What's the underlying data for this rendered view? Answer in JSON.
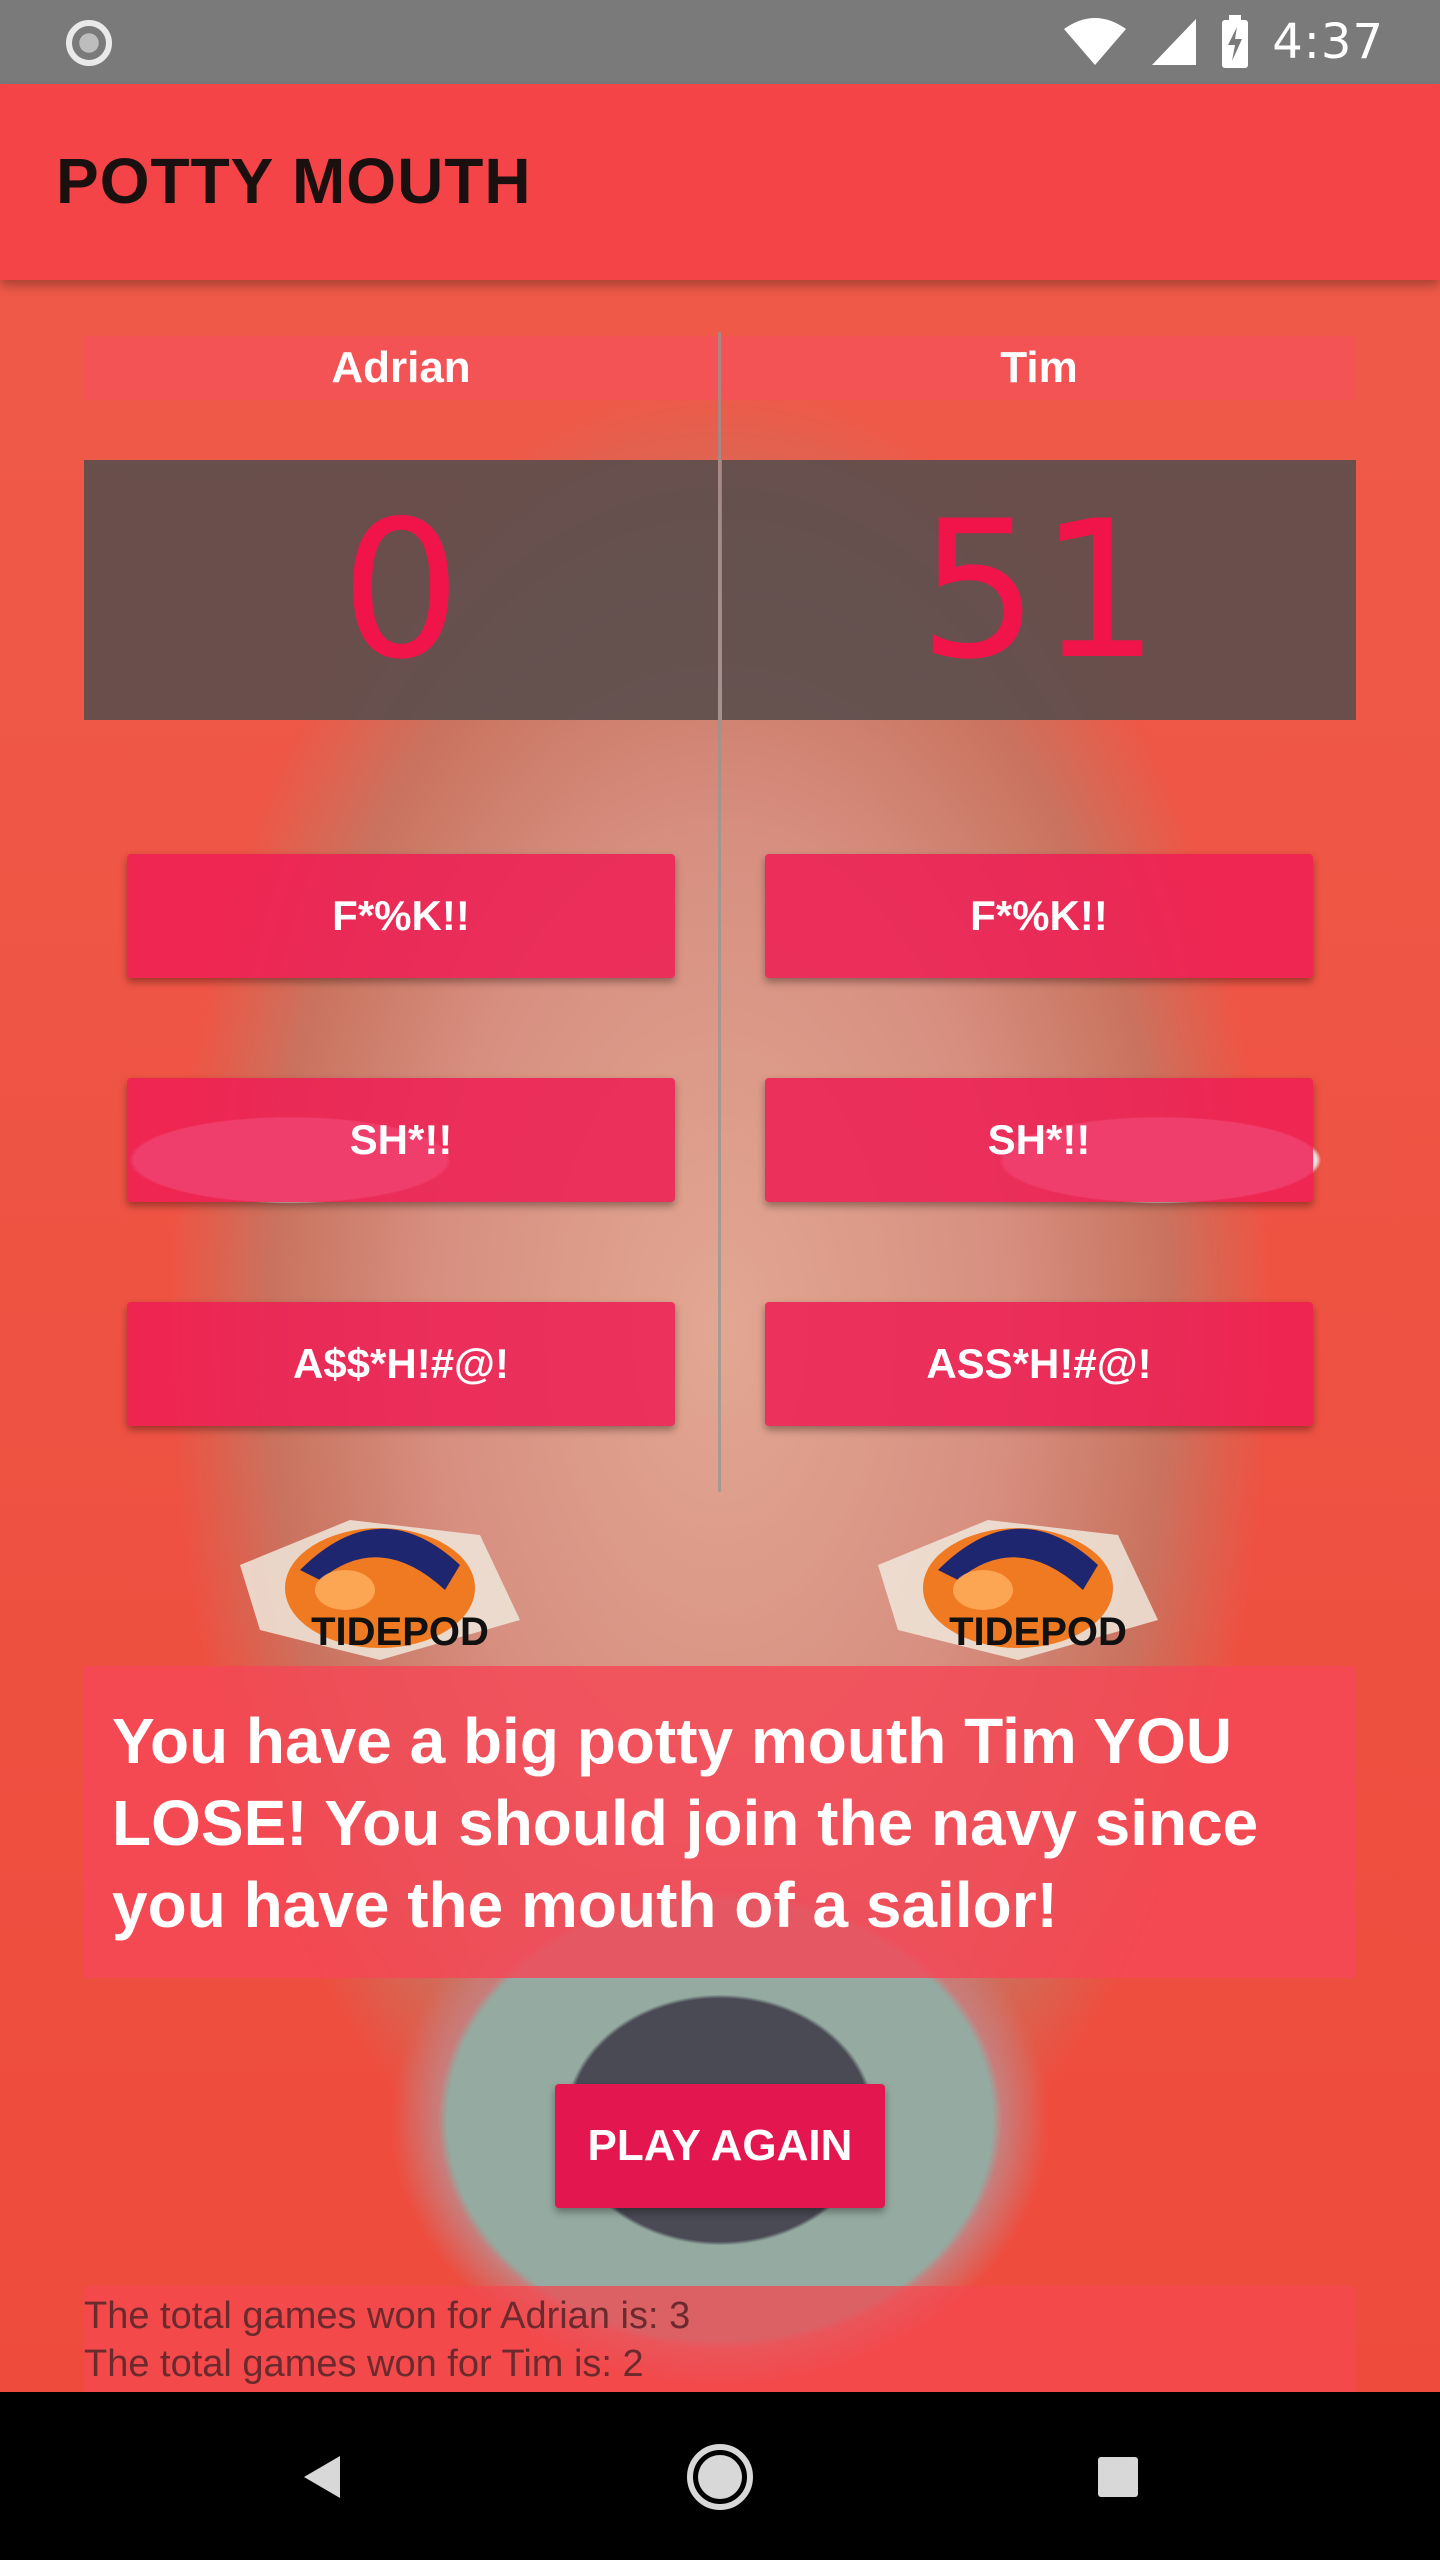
{
  "status_bar": {
    "time": "4:37",
    "icons": [
      "loading-spinner-icon",
      "wifi-icon",
      "cell-signal-icon",
      "battery-charging-icon"
    ]
  },
  "app_bar": {
    "title": "POTTY MOUTH"
  },
  "players": [
    {
      "name": "Adrian",
      "score": "0",
      "buttons": [
        "F*%K!!",
        "SH*!!",
        "A$$*H!#@!"
      ],
      "tidepod_label": "TIDEPOD"
    },
    {
      "name": "Tim",
      "score": "51",
      "buttons": [
        "F*%K!!",
        "SH*!!",
        "ASS*H!#@!"
      ],
      "tidepod_label": "TIDEPOD"
    }
  ],
  "message": "You have a big potty mouth Tim YOU LOSE! You should join the navy since you have the mouth of a sailor!",
  "play_again_label": "PLAY AGAIN",
  "totals": {
    "line1": "The total games won for Adrian is: 3",
    "line2": "The total games won for Tim is: 2"
  },
  "colors": {
    "app_bar": "#f44447",
    "score_text": "#f0144a",
    "button": "#ee1e54",
    "message_box": "#f44856"
  },
  "nav_bar": {
    "icons": [
      "back-icon",
      "home-icon",
      "recents-icon"
    ]
  }
}
